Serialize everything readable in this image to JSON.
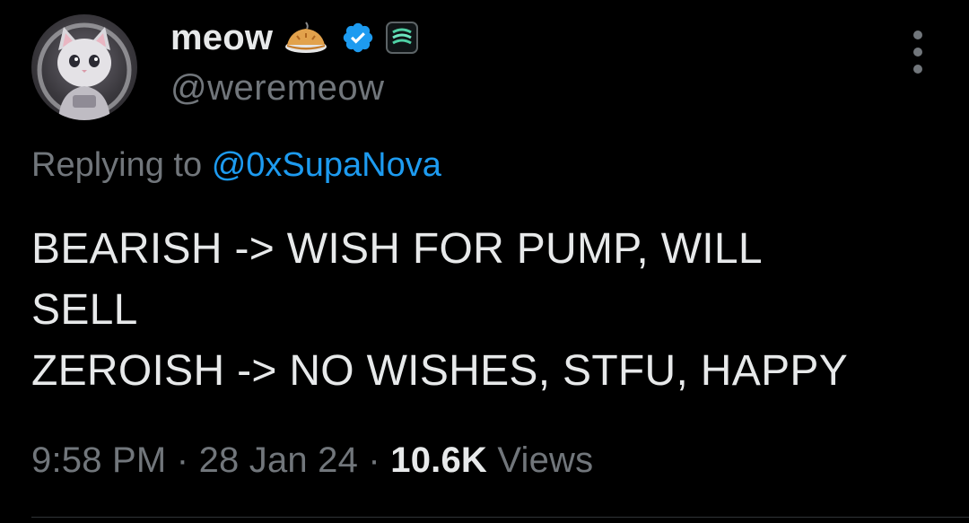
{
  "author": {
    "display_name": "meow",
    "handle": "@weremeow",
    "badges": [
      "pie-emoji-icon",
      "verified-badge-icon",
      "affiliate-badge-icon"
    ]
  },
  "reply": {
    "prefix": "Replying to",
    "mention": "@0xSupaNova"
  },
  "tweet": {
    "text": "BEARISH -> WISH FOR PUMP, WILL\nSELL\nZEROISH -> NO WISHES, STFU, HAPPY"
  },
  "meta": {
    "time": "9:58 PM",
    "separator": "·",
    "date": "28 Jan 24",
    "views_count": "10.6K",
    "views_label": "Views"
  },
  "colors": {
    "background": "#000000",
    "text": "#e7e9ea",
    "secondary": "#71767b",
    "link": "#1d9bf0"
  }
}
